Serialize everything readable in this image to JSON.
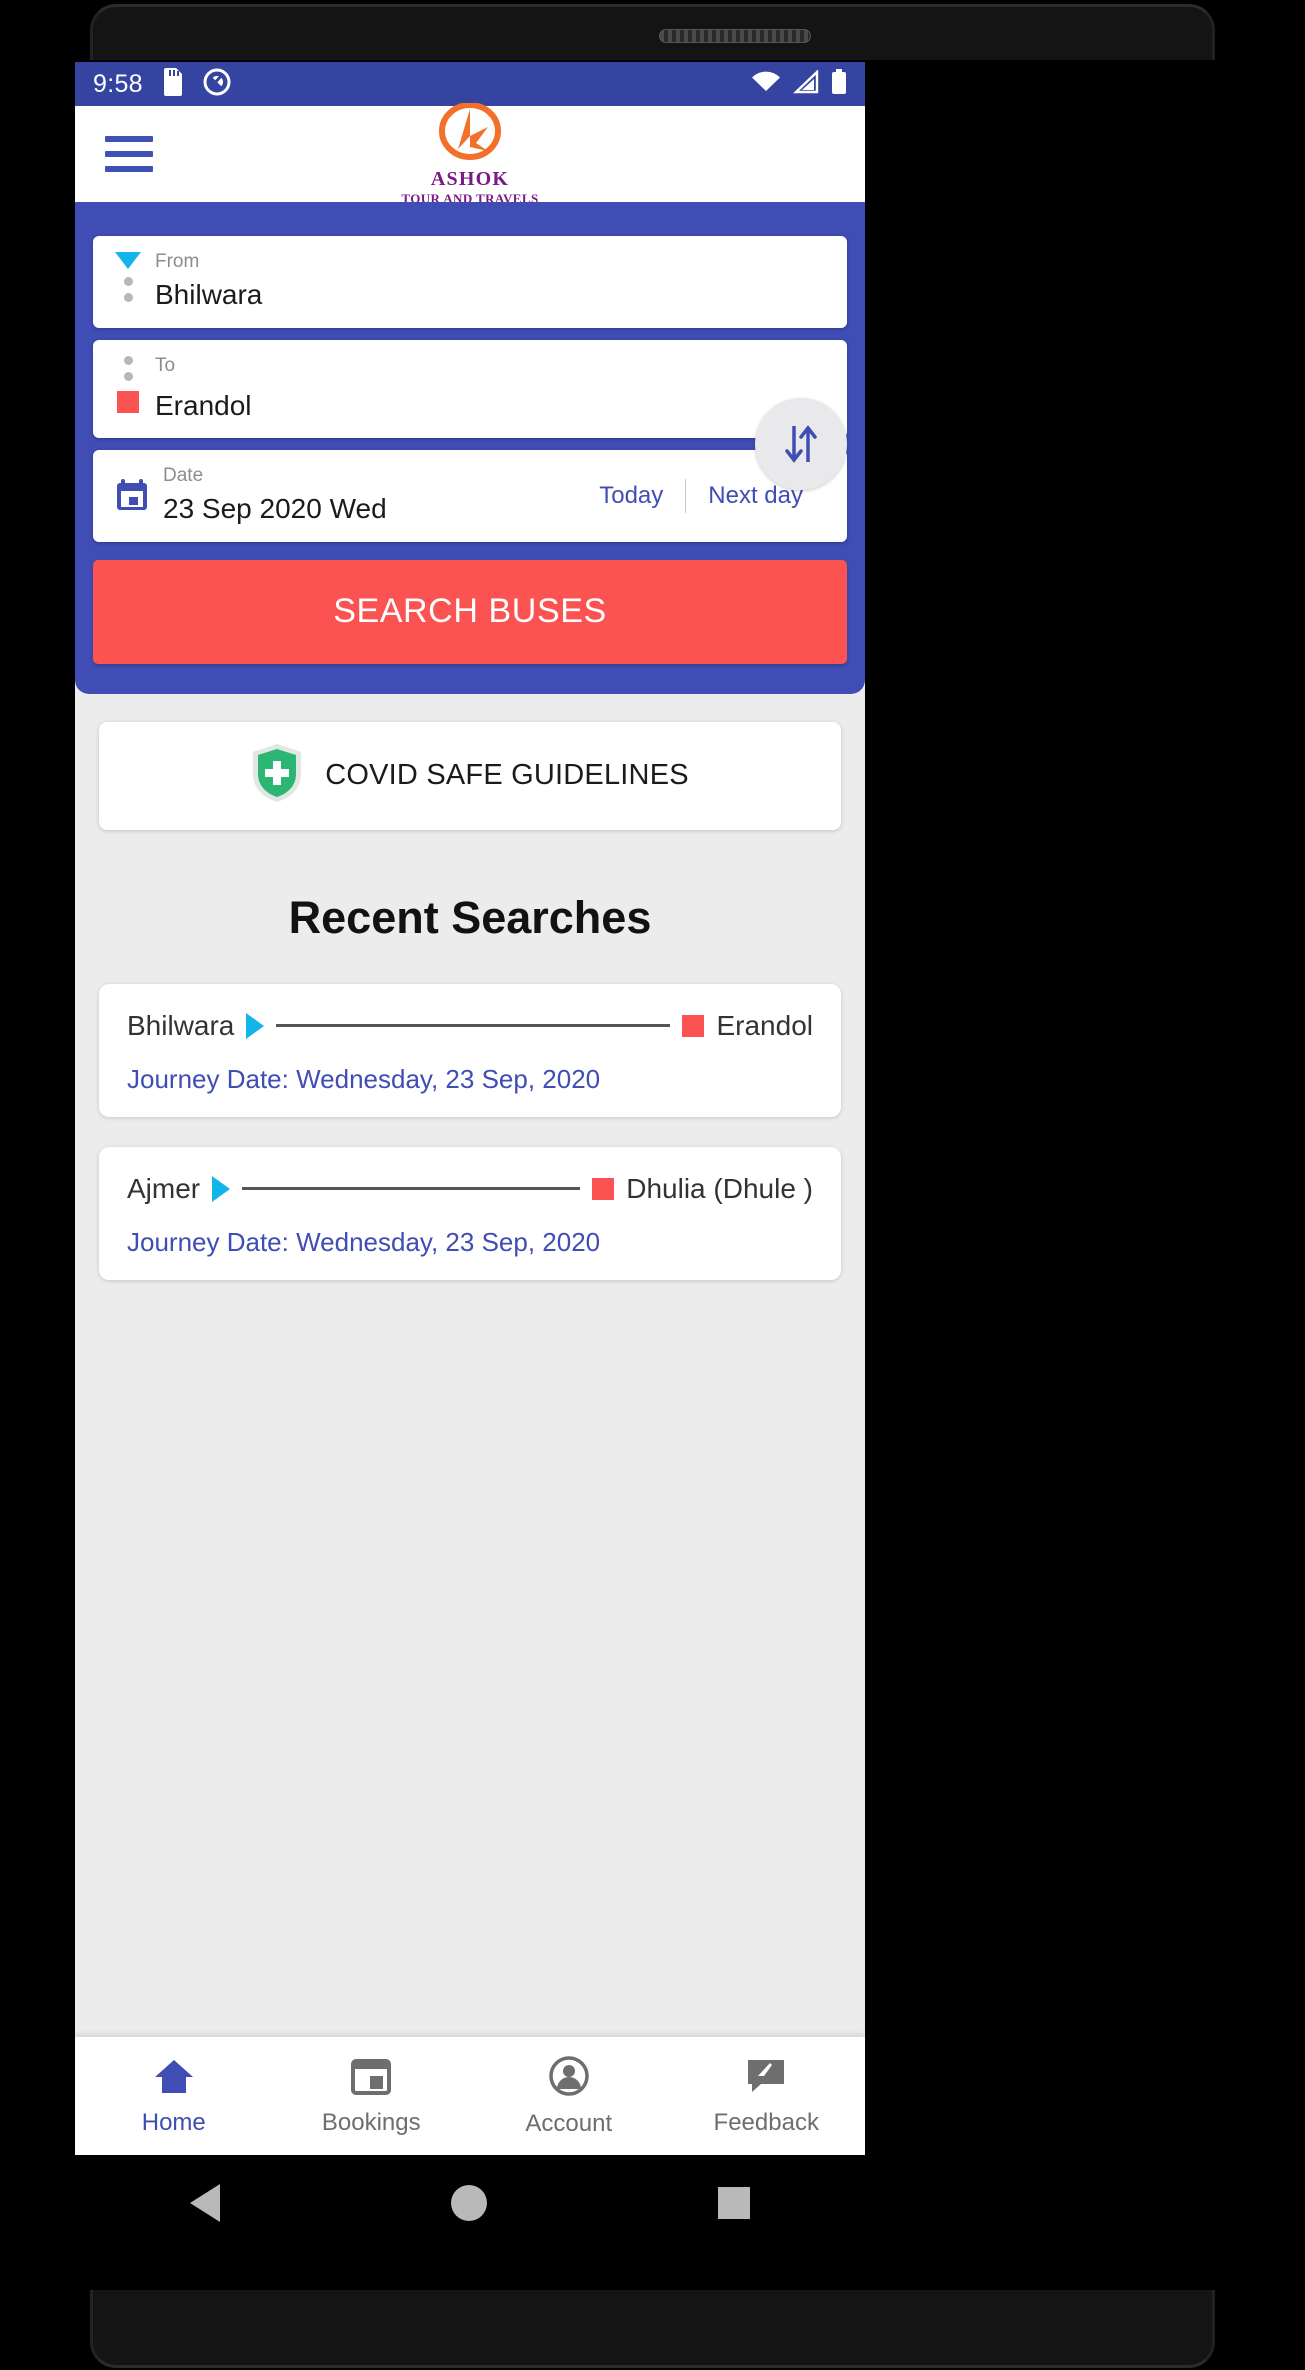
{
  "status_bar": {
    "time": "9:58",
    "icons_left": [
      "sd-card-icon",
      "data-saver-icon"
    ],
    "icons_right": [
      "wifi-icon",
      "cellular-signal-icon",
      "battery-icon"
    ],
    "background_color": "#3544a0"
  },
  "header": {
    "menu_icon": "hamburger-menu-icon",
    "logo_icon": "ashok-arrow-logo-icon",
    "brand_name": "ASHOK",
    "brand_sub": "TOUR AND TRAVELS",
    "brand_color": "#7b1a86",
    "logo_color": "#f2702a"
  },
  "search_panel": {
    "background_color": "#3f4db4",
    "from": {
      "label": "From",
      "value": "Bhilwara",
      "marker_icon": "triangle-down-marker-icon",
      "marker_color": "#12b4ea"
    },
    "to": {
      "label": "To",
      "value": "Erandol",
      "marker_icon": "red-square-marker-icon",
      "marker_color": "#fb5252"
    },
    "swap_button": {
      "icon": "swap-vertical-arrows-icon",
      "label": "Swap from and to"
    },
    "date": {
      "label": "Date",
      "value": "23 Sep 2020 Wed",
      "icon": "calendar-icon",
      "icon_color": "#3f4db4",
      "quick_options": [
        "Today",
        "Next day"
      ]
    },
    "search_button": {
      "label": "SEARCH BUSES",
      "color": "#fb5252"
    }
  },
  "covid_card": {
    "label": "COVID SAFE GUIDELINES",
    "icon": "shield-plus-icon",
    "icon_color": "#2bb673"
  },
  "recent_searches": {
    "title": "Recent Searches",
    "items": [
      {
        "from": "Bhilwara",
        "to": "Erandol",
        "journey_date": "Journey Date: Wednesday, 23 Sep, 2020",
        "from_icon": "triangle-right-marker-icon",
        "to_icon": "red-square-marker-icon"
      },
      {
        "from": "Ajmer",
        "to": "Dhulia (Dhule )",
        "journey_date": "Journey Date: Wednesday, 23 Sep, 2020",
        "from_icon": "triangle-right-marker-icon",
        "to_icon": "red-square-marker-icon"
      }
    ]
  },
  "bottom_nav": {
    "active_index": 0,
    "active_color": "#3f4db4",
    "inactive_color": "#6e6e6e",
    "items": [
      {
        "label": "Home",
        "icon": "home-icon"
      },
      {
        "label": "Bookings",
        "icon": "bookings-calendar-icon"
      },
      {
        "label": "Account",
        "icon": "account-circle-icon"
      },
      {
        "label": "Feedback",
        "icon": "feedback-pencil-icon"
      }
    ]
  },
  "android_nav": {
    "back": "back-triangle-icon",
    "home": "home-circle-icon",
    "recents": "recents-square-icon"
  }
}
